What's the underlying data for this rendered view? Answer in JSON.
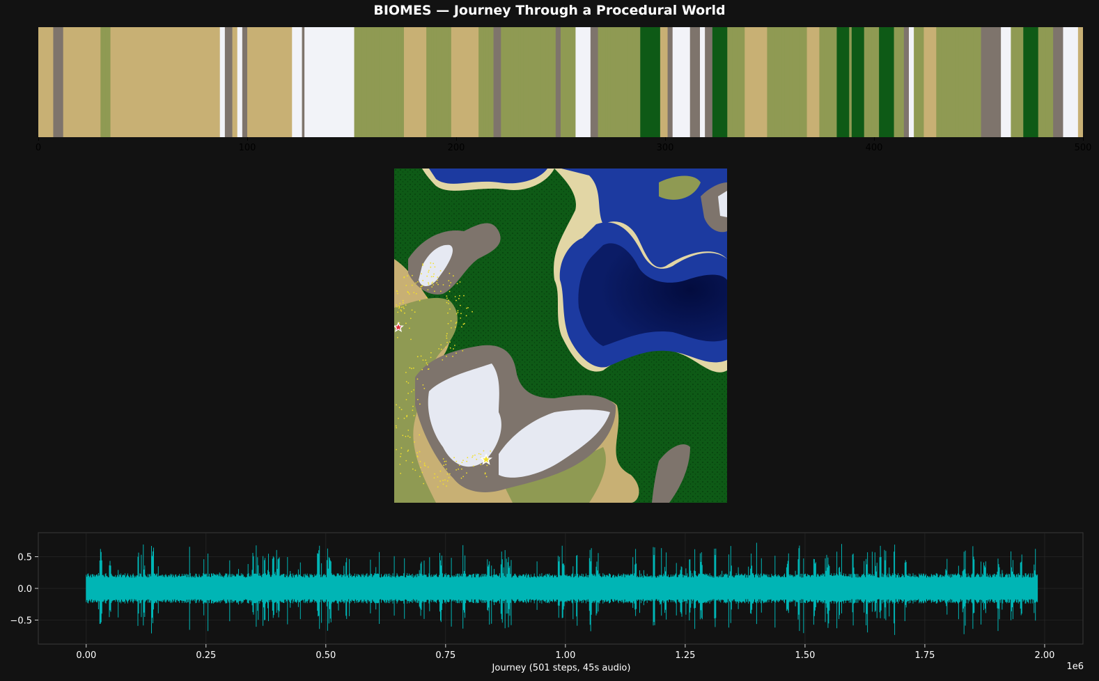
{
  "title": "BIOMES — Journey Through a Procedural World",
  "colors": {
    "background": "#121212",
    "waveform": "#00b5b5",
    "grid": "#2a2a2a",
    "biomes": {
      "desert": "#c8b074",
      "grassland": "#8f9a53",
      "forest": "#0e5a16",
      "mountain": "#7e746c",
      "snow": "#f2f3f8",
      "water_deep": "#0a1a5e",
      "water_shallow": "#1c3aa0",
      "beach": "#e2d6a5"
    }
  },
  "chart_data": [
    {
      "type": "heatmap",
      "title": "BIOMES — Journey Through a Procedural World",
      "x_ticks": [
        "0",
        "100",
        "200",
        "300",
        "400",
        "500"
      ],
      "xlim": [
        0,
        500
      ],
      "biome_sequence": "DDDDDDMMMMDDDDDDDDDDDDDDDGGGGDDDDDDDDDDDDDDDDDDDDDDDDDDDDDDDDDDDDDDDDDDDDSSMMMDDSSMMDDDDDDDDDDDDDDDDDDSSSSMSSSSSSSSSSSSSSSSSSSSGGGGGGGGGGGGGGGGGGGGDDDDDDDDDGGGGGGGGGGDDDDDDDDDDDGGGGGGMMMGGGGGGGGGGGGGGGGGGGGGGMMGGGGGGSSSSSSMMMGGGGGGGGGGGGGGGGGFFFFFFFFDDDMMSSSSSSSMMMMSSMMMFFFFFFGGGGGGGDDDDDDDDDGGGGGGGGGGGGGGGGDDDDDGGGGGGGFFFFFGFFFFFGGGGGGFFFFFFGGGGMMSSGGGGDDDDDGGGGGGGGGGGGGGGGGGMMMMMMMMSSSSGGGGGFFFFFFGGGGGGMMMMSSSSSSDD"
    },
    {
      "type": "heatmap",
      "map_image": "procedural-world-map",
      "start_marker": "red-star",
      "end_marker": "yellow-star",
      "path_color": "#f2e02b"
    },
    {
      "type": "line",
      "series": [
        {
          "values_description_range": [
            -0.75,
            0.75
          ]
        }
      ],
      "xlabel": "Journey (501 steps, 45s audio)",
      "x_ticks": [
        "0.00",
        "0.25",
        "0.50",
        "0.75",
        "1.00",
        "1.25",
        "1.50",
        "1.75",
        "2.00"
      ],
      "x_multiplier": "1e6",
      "y_ticks": [
        "0.5",
        "0.0",
        "−0.5"
      ],
      "xlim": [
        -0.1,
        2.08
      ],
      "ylim": [
        -0.88,
        0.88
      ],
      "data_x_range": [
        0.0,
        1.985
      ],
      "grid": true
    }
  ]
}
